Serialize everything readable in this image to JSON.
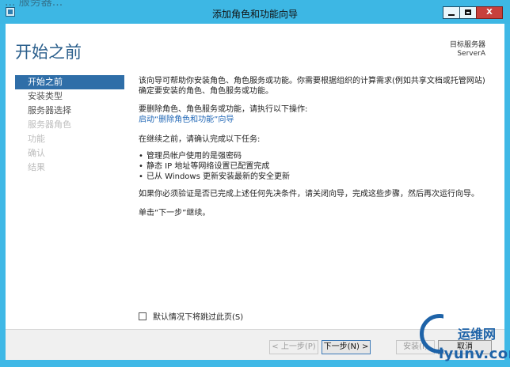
{
  "background_fragment": "... 服务器...",
  "window": {
    "title": "添加角色和功能向导",
    "controls": {
      "minimize": "",
      "maximize": "",
      "close": "X"
    }
  },
  "page": {
    "title": "开始之前"
  },
  "target_server": {
    "label": "目标服务器",
    "name": "ServerA"
  },
  "nav": {
    "items": [
      {
        "label": "开始之前",
        "state": "active"
      },
      {
        "label": "安装类型",
        "state": "enabled"
      },
      {
        "label": "服务器选择",
        "state": "enabled"
      },
      {
        "label": "服务器角色",
        "state": "disabled"
      },
      {
        "label": "功能",
        "state": "disabled"
      },
      {
        "label": "确认",
        "state": "disabled"
      },
      {
        "label": "结果",
        "state": "disabled"
      }
    ]
  },
  "content": {
    "intro": "该向导可帮助你安装角色、角色服务或功能。你需要根据组织的计算需求(例如共享文档或托管网站)确定要安装的角色、角色服务或功能。",
    "remove_prompt": "要删除角色、角色服务或功能，请执行以下操作:",
    "remove_link": "启动“删除角色和功能”向导",
    "before_continue": "在继续之前，请确认完成以下任务:",
    "tasks": [
      "管理员帐户使用的是强密码",
      "静态 IP 地址等网络设置已配置完成",
      "已从 Windows 更新安装最新的安全更新"
    ],
    "verify_text": "如果你必须验证是否已完成上述任何先决条件，请关闭向导，完成这些步骤，然后再次运行向导。",
    "continue_text": "单击“下一步”继续。"
  },
  "skip_option": {
    "label": "默认情况下将跳过此页(S)",
    "checked": false
  },
  "footer": {
    "prev": "< 上一步(P)",
    "next": "下一步(N) >",
    "install": "安装(I)",
    "cancel": "取消"
  },
  "watermark": {
    "text1": "运维网",
    "text2": "iyunv.com"
  },
  "colors": {
    "titlebar": "#3db7e4",
    "accent": "#2f6ea8",
    "link": "#1f66b5"
  }
}
